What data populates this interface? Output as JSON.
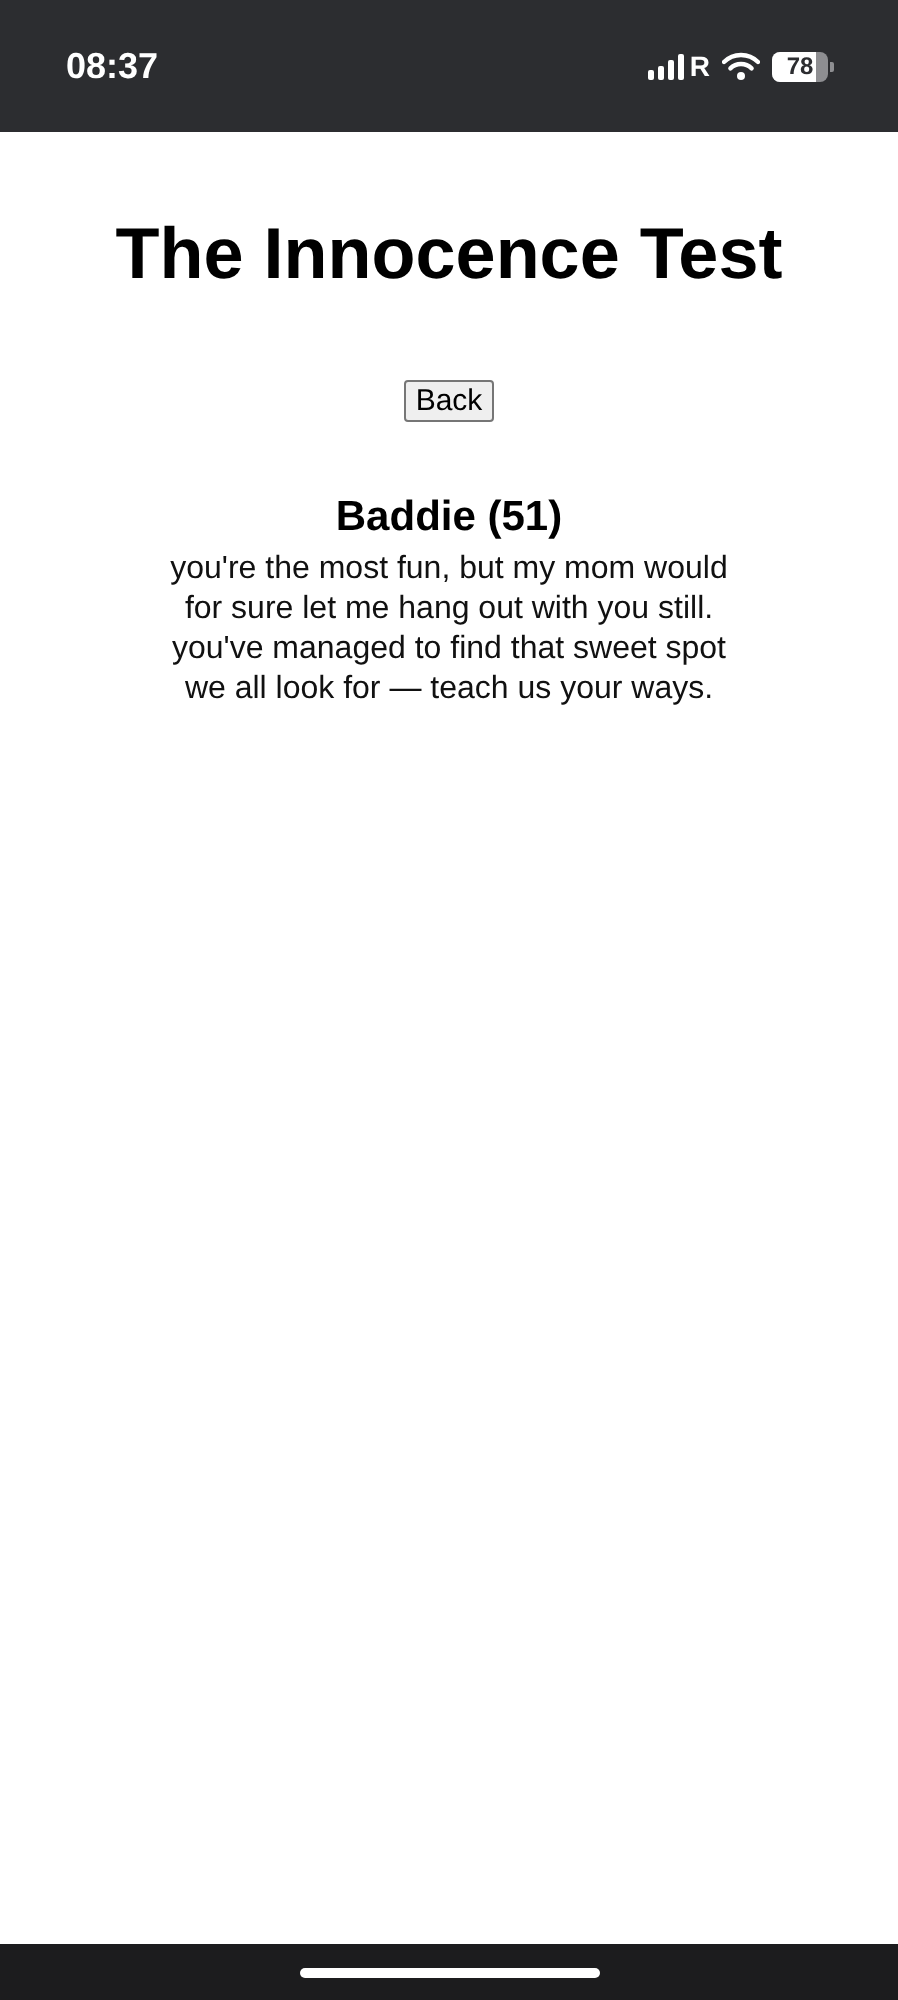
{
  "status_bar": {
    "time": "08:37",
    "carrier": "R",
    "battery": "78"
  },
  "title": "The Innocence Test",
  "back_button": "Back",
  "result": {
    "heading": "Baddie (51)",
    "description": "you're the most fun, but my mom would for sure let me hang out with you still. you've managed to find that sweet spot we all look for — teach us your ways."
  }
}
